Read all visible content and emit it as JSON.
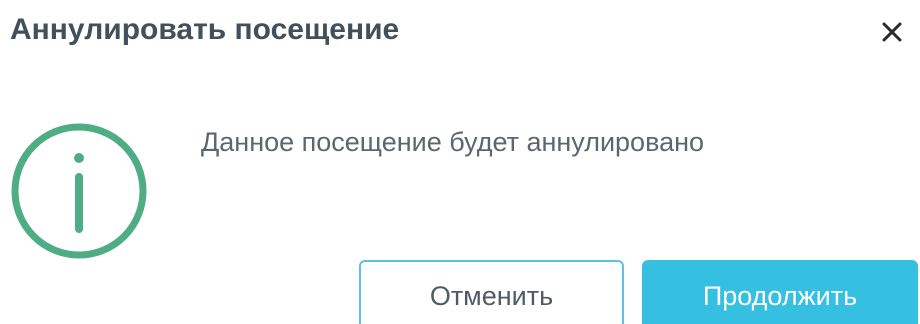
{
  "dialog": {
    "title": "Аннулировать посещение",
    "message": "Данное посещение будет аннулировано",
    "icon": "info-icon",
    "close_icon": "close-icon",
    "buttons": {
      "cancel_label": "Отменить",
      "continue_label": "Продолжить"
    }
  },
  "colors": {
    "accent": "#35bfe1",
    "info_icon": "#4fad86",
    "title": "#43505c",
    "text": "#5d6670"
  }
}
